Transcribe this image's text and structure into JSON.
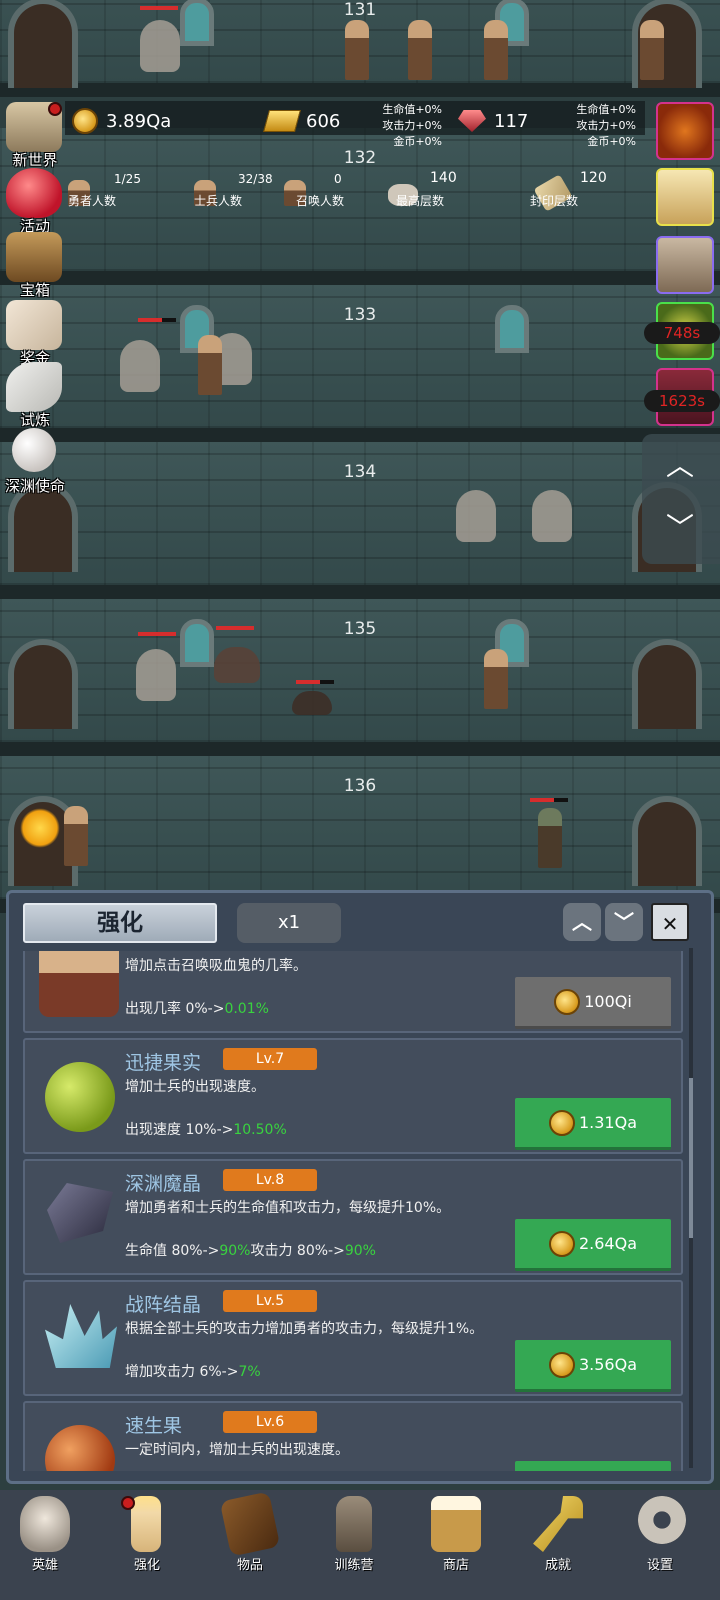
{
  "floors": [
    "131",
    "132",
    "133",
    "134",
    "135",
    "136"
  ],
  "resources": {
    "coins": "3.89Qa",
    "gold": "606",
    "gems": "117"
  },
  "bonus_left": [
    "生命值+0%",
    "攻击力+0%",
    "金币+0%"
  ],
  "bonus_right": [
    "生命值+0%",
    "攻击力+0%",
    "金币+0%"
  ],
  "stats": {
    "heroes": {
      "value": "1/25",
      "label": "勇者人数"
    },
    "soldiers": {
      "value": "32/38",
      "label": "士兵人数"
    },
    "summons": {
      "value": "0",
      "label": "召唤人数"
    },
    "max_floor": {
      "value": "140",
      "label": "最高层数"
    },
    "sealed_floor": {
      "value": "120",
      "label": "封印层数"
    }
  },
  "side_menu": [
    "新世界",
    "活动",
    "宝箱",
    "奖金",
    "试炼",
    "深渊使命"
  ],
  "timers": [
    "748s",
    "1623s"
  ],
  "scroll_arrows": {
    "up": "︿",
    "down": "﹀"
  },
  "panel": {
    "tab": "强化",
    "multiplier": "x1",
    "up_btn": "︿",
    "down_btn": "﹀",
    "close_btn": "✕",
    "items": [
      {
        "name": "",
        "level": "",
        "desc": "增加点击召唤吸血鬼的几率。",
        "effect_prefix": "出现几率 0%->",
        "effect_new": "0.01%",
        "effect_prefix2": "",
        "effect_new2": "",
        "price": "100Qi",
        "affordable": false
      },
      {
        "name": "迅捷果实",
        "level": "Lv.7",
        "desc": "增加士兵的出现速度。",
        "effect_prefix": "出现速度 10%->",
        "effect_new": "10.50%",
        "effect_prefix2": "",
        "effect_new2": "",
        "price": "1.31Qa",
        "affordable": true
      },
      {
        "name": "深渊魔晶",
        "level": "Lv.8",
        "desc": "增加勇者和士兵的生命值和攻击力，每级提升10%。",
        "effect_prefix": "生命值 80%->",
        "effect_new": "90%",
        "effect_prefix2": "攻击力 80%->",
        "effect_new2": "90%",
        "price": "2.64Qa",
        "affordable": true
      },
      {
        "name": "战阵结晶",
        "level": "Lv.5",
        "desc": "根据全部士兵的攻击力增加勇者的攻击力，每级提升1%。",
        "effect_prefix": "增加攻击力 6%->",
        "effect_new": "7%",
        "effect_prefix2": "",
        "effect_new2": "",
        "price": "3.56Qa",
        "affordable": true
      },
      {
        "name": "速生果",
        "level": "Lv.6",
        "desc": "一定时间内，增加士兵的出现速度。",
        "effect_prefix": "",
        "effect_new": "",
        "effect_prefix2": "",
        "effect_new2": "",
        "price": "",
        "affordable": true
      }
    ]
  },
  "bottom_nav": [
    "英雄",
    "强化",
    "物品",
    "训练营",
    "商店",
    "成就",
    "设置"
  ],
  "colors": {
    "accent_green": "#34a853",
    "level_orange": "#e07a1d",
    "item_name": "#9fc6e4",
    "timer_red": "#e02424"
  }
}
